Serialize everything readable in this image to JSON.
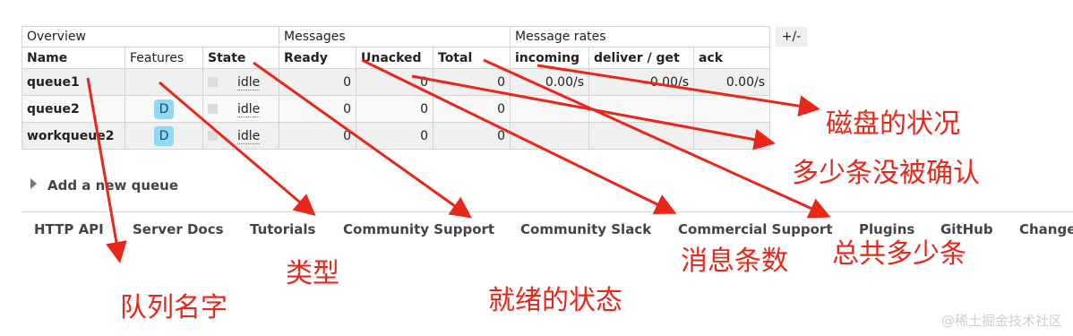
{
  "table": {
    "groups": {
      "overview": "Overview",
      "messages": "Messages",
      "message_rates": "Message rates"
    },
    "columns": {
      "name": "Name",
      "features": "Features",
      "state": "State",
      "ready": "Ready",
      "unacked": "Unacked",
      "total": "Total",
      "incoming": "incoming",
      "deliver_get": "deliver / get",
      "ack": "ack"
    },
    "toggle_label": "+/-",
    "rows": [
      {
        "name": "queue1",
        "feature": "",
        "state": "idle",
        "ready": "0",
        "unacked": "0",
        "total": "0",
        "incoming": "0.00/s",
        "deliver_get": "0.00/s",
        "ack": "0.00/s"
      },
      {
        "name": "queue2",
        "feature": "D",
        "state": "idle",
        "ready": "0",
        "unacked": "0",
        "total": "0",
        "incoming": "",
        "deliver_get": "",
        "ack": ""
      },
      {
        "name": "workqueue2",
        "feature": "D",
        "state": "idle",
        "ready": "0",
        "unacked": "0",
        "total": "0",
        "incoming": "",
        "deliver_get": "",
        "ack": ""
      }
    ]
  },
  "add_queue": "Add a new queue",
  "footer": {
    "links": [
      "HTTP API",
      "Server Docs",
      "Tutorials",
      "Community Support",
      "Community Slack",
      "Commercial Support",
      "Plugins",
      "GitHub",
      "Change"
    ]
  },
  "annotations": {
    "disk": "磁盘的状况",
    "unacked": "多少条没被确认",
    "total": "总共多少条",
    "ready": "消息条数",
    "state": "就绪的状态",
    "type": "类型",
    "name": "队列名字"
  },
  "watermark": "@稀土掘金技术社区",
  "colors": {
    "annotation": "#e8261a",
    "badge": "#8fd8f6"
  }
}
